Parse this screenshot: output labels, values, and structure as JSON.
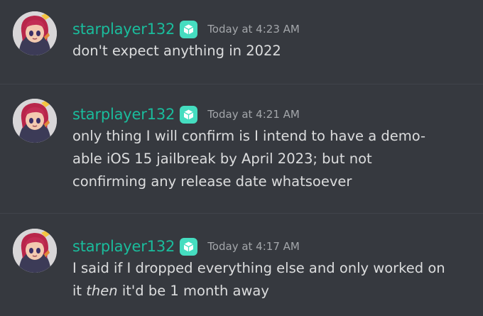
{
  "messages": [
    {
      "username": "starplayer132",
      "timestamp": "Today at 4:23 AM",
      "lines": [
        "don't expect anything in 2022"
      ]
    },
    {
      "username": "starplayer132",
      "timestamp": "Today at 4:21 AM",
      "lines": [
        "only thing I will confirm is I intend to have a demo-",
        "able iOS 15 jailbreak by April 2023; but not",
        "confirming any release date whatsoever"
      ]
    },
    {
      "username": "starplayer132",
      "timestamp": "Today at 4:17 AM",
      "lines": [
        "I said if I dropped everything else and only worked on"
      ],
      "line2_before": "it ",
      "line2_emphasis": "then",
      "line2_after": " it'd be 1 month away"
    }
  ],
  "colors": {
    "background": "#36393f",
    "username": "#1abc9c",
    "badge": "#45ddc0",
    "timestamp": "#a3a6aa",
    "text": "#dcddde"
  },
  "icons": {
    "avatar": "anime-girl-avatar",
    "badge": "cube-badge-icon"
  }
}
